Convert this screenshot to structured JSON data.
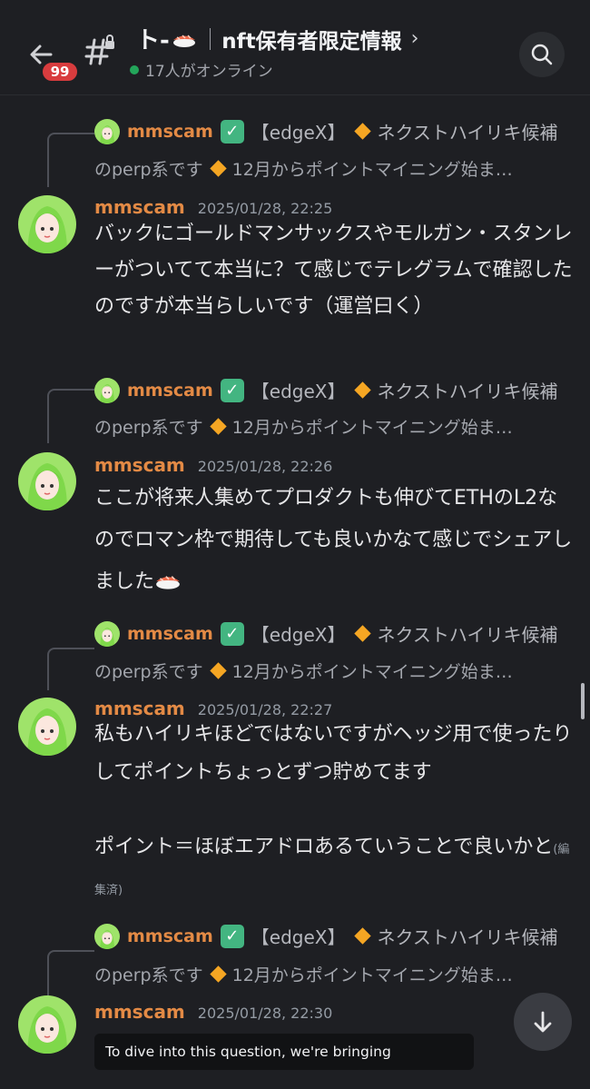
{
  "header": {
    "back_badge": "99",
    "title_prefix": "ト-",
    "title": "nft保有者限定情報",
    "chevron": "›",
    "online": "17人がオンライン"
  },
  "messages": [
    {
      "reply": {
        "author": "mmscam",
        "tag": "【edgeX】",
        "preview1": "ネクストハイリキ候補",
        "preview2a": "のperp系です",
        "preview2b": "12月からポイントマイニング始ま…"
      },
      "author": "mmscam",
      "timestamp": "2025/01/28, 22:25",
      "body": "バックにゴールドマンサックスやモルガン・スタンレーがついてて本当に？て感じでテレグラムで確認したのですが本当らしいです（運営曰く）"
    },
    {
      "reply": {
        "author": "mmscam",
        "tag": "【edgeX】",
        "preview1": "ネクストハイリキ候補",
        "preview2a": "のperp系です",
        "preview2b": "12月からポイントマイニング始ま…"
      },
      "author": "mmscam",
      "timestamp": "2025/01/28, 22:26",
      "body": "ここが将来人集めてプロダクトも伸びてETHのL2なのでロマン枠で期待しても良いかなて感じでシェアしました"
    },
    {
      "reply": {
        "author": "mmscam",
        "tag": "【edgeX】",
        "preview1": "ネクストハイリキ候補",
        "preview2a": "のperp系です",
        "preview2b": "12月からポイントマイニング始ま…"
      },
      "author": "mmscam",
      "timestamp": "2025/01/28, 22:27",
      "body": "私もハイリキほどではないですがヘッジ用で使ったりしてポイントちょっとずつ貯めてます",
      "body2": "ポイント＝ほぼエアドロあるていうことで良いかと",
      "edited": "(編集済)"
    },
    {
      "reply": {
        "author": "mmscam",
        "tag": "【edgeX】",
        "preview1": "ネクストハイリキ候補",
        "preview2a": "のperp系です",
        "preview2b": "12月からポイントマイニング始ま…"
      },
      "author": "mmscam",
      "timestamp": "2025/01/28, 22:30"
    }
  ],
  "toast": "To dive into this question, we're bringing",
  "icons": {
    "back": "arrow-left-icon",
    "channel": "locked-hash-icon",
    "search": "search-icon",
    "jump": "arrow-down-icon",
    "verified": "check-mark-icon",
    "bullet": "orange-diamond-icon"
  },
  "colors": {
    "background": "#1e1f23",
    "author": "#e38a45",
    "badge": "#d83c3e",
    "online": "#23a55a",
    "check": "#43b581",
    "diamond": "#f5a623"
  }
}
